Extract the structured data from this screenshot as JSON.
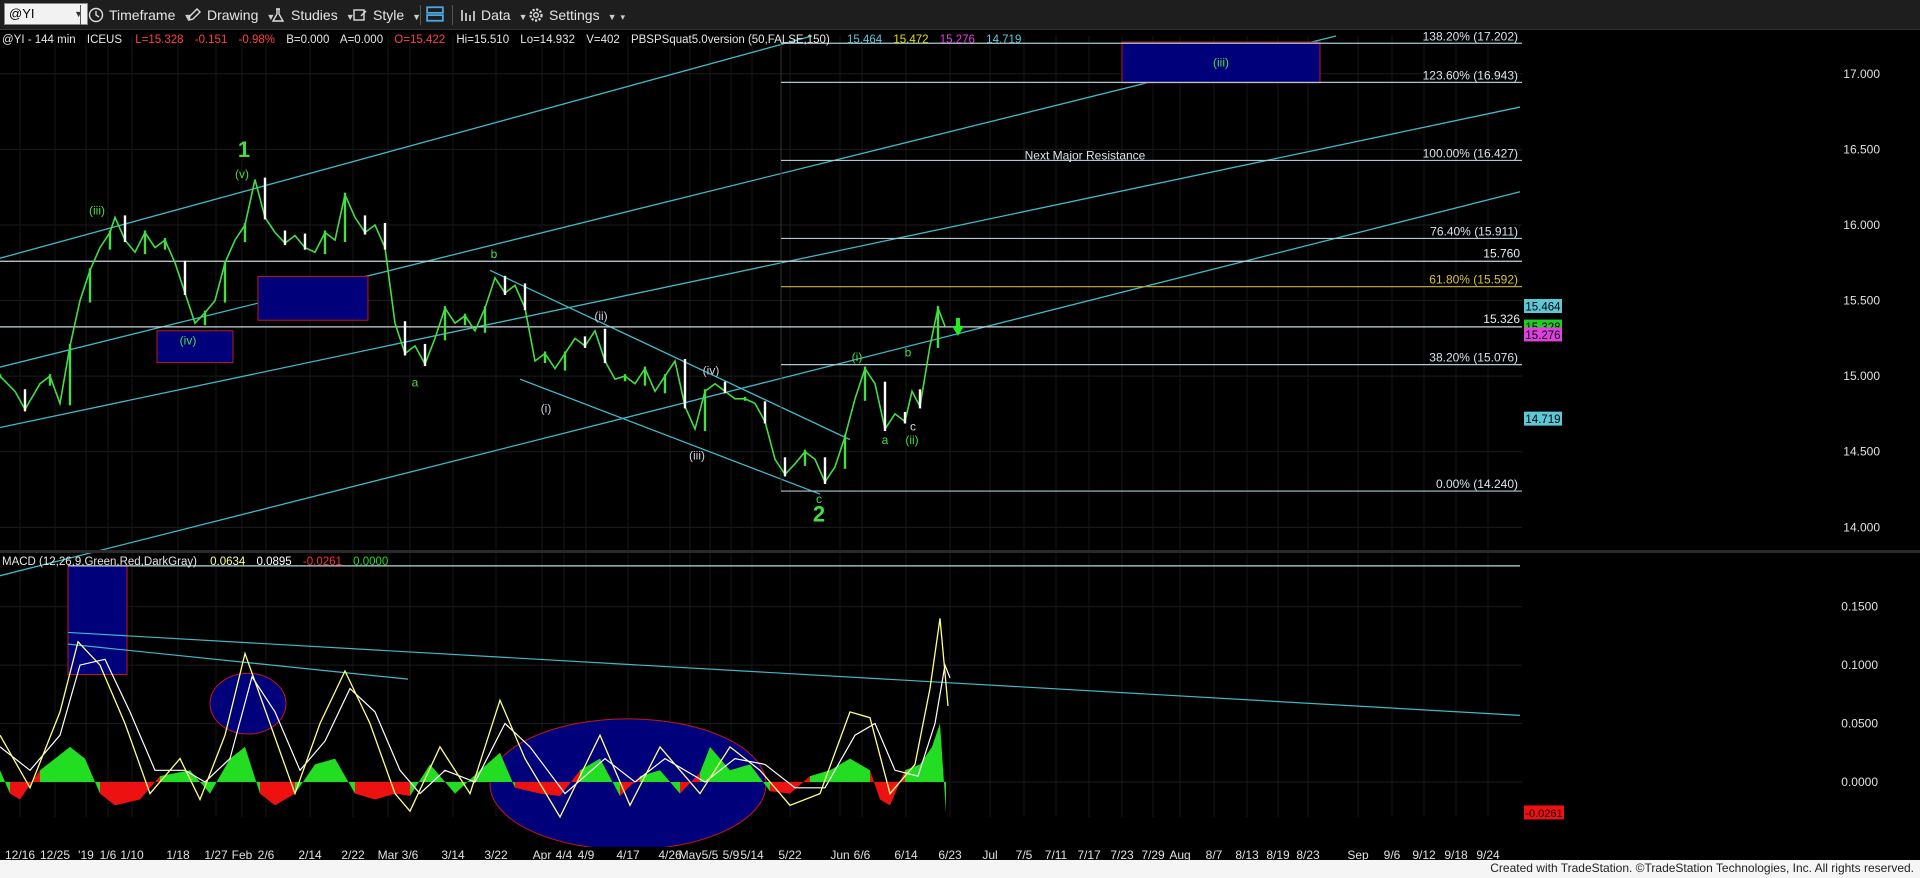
{
  "toolbar": {
    "symbol": "@YI",
    "timeframe": "Timeframe",
    "drawing": "Drawing",
    "studies": "Studies",
    "style": "Style",
    "data": "Data",
    "settings": "Settings"
  },
  "chart_header": {
    "symbol_desc": "@YI - 144 min",
    "exchange": "ICEUS",
    "last": "L=15.328",
    "change": "-0.151",
    "change_pct": "-0.98%",
    "bid": "B=0.000",
    "ask": "A=0.000",
    "open": "O=15.422",
    "hi": "Hi=15.510",
    "lo": "Lo=14.932",
    "volume": "V=402",
    "study": "PBSPSquat5.0version (50,FALSE,150)",
    "study_values": [
      {
        "value": "15.464",
        "color": "#5ec8d8"
      },
      {
        "value": "15.472",
        "color": "#e0e000"
      },
      {
        "value": "15.276",
        "color": "#e040e0"
      },
      {
        "value": "14.719",
        "color": "#5ec8d8"
      }
    ]
  },
  "colors": {
    "background": "#000000",
    "channel": "#40b8c8",
    "box_fill": "#00007a",
    "box_stroke": "#c01818",
    "wave_label": "#44dd44",
    "wave_label_white": "#d0d0e0",
    "price_line": "#4ea8d0",
    "candle_up": "#44dd44",
    "candle_down": "#ffffff",
    "macd_line": "#ffff88",
    "signal_line": "#ffffff",
    "hist_pos": "#22dd22",
    "hist_neg": "#ee1111",
    "fib_line": "#aac8d0",
    "fib_gold": "#b8a030"
  },
  "chart_data": {
    "type": "candlestick",
    "symbol": "@YI",
    "interval": "144 min",
    "ylim": [
      13.85,
      17.25
    ],
    "y_ticks": [
      "17.000",
      "16.500",
      "16.000",
      "15.500",
      "15.000",
      "14.500",
      "14.000"
    ],
    "x_ticks": [
      "12/16",
      "12/25",
      "'19",
      "1/6",
      "1/10",
      "1/18",
      "1/27",
      "Feb",
      "2/6",
      "2/14",
      "2/22",
      "Mar",
      "3/6",
      "3/14",
      "3/22",
      "Apr",
      "4/4",
      "4/9",
      "4/17",
      "4/26",
      "May",
      "5/5",
      "5/9",
      "5/14",
      "5/22",
      "Jun",
      "6/6",
      "6/14",
      "6/23",
      "Jul",
      "7/5",
      "7/11",
      "7/17",
      "7/23",
      "7/29",
      "Aug",
      "8/7",
      "8/13",
      "8/19",
      "8/23",
      "Sep",
      "9/6",
      "9/12",
      "9/18",
      "9/24"
    ],
    "price_path": [
      [
        0,
        15.0
      ],
      [
        15,
        14.9
      ],
      [
        25,
        14.78
      ],
      [
        40,
        14.95
      ],
      [
        50,
        15.0
      ],
      [
        60,
        14.82
      ],
      [
        70,
        15.2
      ],
      [
        80,
        15.5
      ],
      [
        90,
        15.7
      ],
      [
        100,
        15.85
      ],
      [
        110,
        15.95
      ],
      [
        115,
        16.05
      ],
      [
        125,
        15.9
      ],
      [
        135,
        15.82
      ],
      [
        145,
        15.95
      ],
      [
        155,
        15.85
      ],
      [
        165,
        15.9
      ],
      [
        175,
        15.75
      ],
      [
        185,
        15.55
      ],
      [
        195,
        15.35
      ],
      [
        205,
        15.42
      ],
      [
        215,
        15.5
      ],
      [
        225,
        15.75
      ],
      [
        235,
        15.9
      ],
      [
        245,
        16.0
      ],
      [
        255,
        16.3
      ],
      [
        265,
        16.05
      ],
      [
        275,
        15.95
      ],
      [
        285,
        15.88
      ],
      [
        295,
        15.93
      ],
      [
        305,
        15.85
      ],
      [
        315,
        15.82
      ],
      [
        325,
        15.95
      ],
      [
        335,
        15.9
      ],
      [
        345,
        16.2
      ],
      [
        355,
        16.05
      ],
      [
        365,
        15.95
      ],
      [
        375,
        16.0
      ],
      [
        385,
        15.85
      ],
      [
        395,
        15.35
      ],
      [
        405,
        15.15
      ],
      [
        415,
        15.2
      ],
      [
        425,
        15.08
      ],
      [
        435,
        15.25
      ],
      [
        445,
        15.45
      ],
      [
        455,
        15.35
      ],
      [
        465,
        15.4
      ],
      [
        475,
        15.3
      ],
      [
        485,
        15.45
      ],
      [
        495,
        15.65
      ],
      [
        505,
        15.55
      ],
      [
        515,
        15.6
      ],
      [
        525,
        15.45
      ],
      [
        535,
        15.1
      ],
      [
        545,
        15.15
      ],
      [
        555,
        15.05
      ],
      [
        565,
        15.15
      ],
      [
        575,
        15.25
      ],
      [
        585,
        15.2
      ],
      [
        595,
        15.3
      ],
      [
        605,
        15.1
      ],
      [
        615,
        14.98
      ],
      [
        625,
        15.0
      ],
      [
        635,
        14.95
      ],
      [
        645,
        15.05
      ],
      [
        655,
        14.9
      ],
      [
        665,
        15.0
      ],
      [
        675,
        15.1
      ],
      [
        685,
        14.8
      ],
      [
        695,
        14.65
      ],
      [
        705,
        14.9
      ],
      [
        715,
        14.95
      ],
      [
        725,
        14.9
      ],
      [
        735,
        14.85
      ],
      [
        745,
        14.85
      ],
      [
        755,
        14.82
      ],
      [
        765,
        14.7
      ],
      [
        775,
        14.45
      ],
      [
        785,
        14.35
      ],
      [
        795,
        14.42
      ],
      [
        805,
        14.5
      ],
      [
        815,
        14.45
      ],
      [
        825,
        14.3
      ],
      [
        835,
        14.4
      ],
      [
        845,
        14.6
      ],
      [
        855,
        14.85
      ],
      [
        865,
        15.05
      ],
      [
        875,
        14.95
      ],
      [
        885,
        14.65
      ],
      [
        895,
        14.75
      ],
      [
        905,
        14.7
      ],
      [
        912,
        14.9
      ],
      [
        920,
        14.8
      ],
      [
        930,
        15.2
      ],
      [
        938,
        15.45
      ],
      [
        945,
        15.33
      ]
    ],
    "fibonacci": {
      "x_start": 781,
      "levels": [
        {
          "label": "138.20% (17.202)",
          "value": 17.202
        },
        {
          "label": "123.60% (16.943)",
          "value": 16.943
        },
        {
          "label": "100.00% (16.427)",
          "value": 16.427
        },
        {
          "label": "76.40% (15.911)",
          "value": 15.911
        },
        {
          "label": "61.80% (15.592)",
          "value": 15.592
        },
        {
          "label": "38.20% (15.076)",
          "value": 15.076
        },
        {
          "label": "0.00% (14.240)",
          "value": 14.24
        }
      ]
    },
    "horizontal_lines": [
      {
        "label": "15.760",
        "value": 15.76
      },
      {
        "label": "15.326",
        "value": 15.326
      }
    ],
    "annotations": [
      {
        "text": "Next Major Resistance",
        "x": 1085,
        "value": 16.46
      }
    ],
    "price_markers": [
      {
        "label": "15.464",
        "value": 15.464,
        "bg": "#5ec8d8",
        "fg": "#000"
      },
      {
        "label": "15.328",
        "value": 15.328,
        "bg": "#22cc22",
        "fg": "#000"
      },
      {
        "label": "15.276",
        "value": 15.276,
        "bg": "#e040e0",
        "fg": "#000"
      },
      {
        "label": "14.719",
        "value": 14.719,
        "bg": "#5ec8d8",
        "fg": "#000"
      }
    ],
    "boxes": [
      {
        "x0": 157,
        "x1": 233,
        "v0": 15.3,
        "v1": 15.09
      },
      {
        "x0": 258,
        "x1": 368,
        "v0": 15.66,
        "v1": 15.37
      },
      {
        "x0": 1122,
        "x1": 1320,
        "v0": 17.21,
        "v1": 16.94,
        "label": "(iii)"
      }
    ],
    "channels": [
      [
        [
          0,
          15.78
        ],
        [
          812,
          17.25
        ]
      ],
      [
        [
          0,
          15.06
        ],
        [
          1336,
          17.25
        ]
      ],
      [
        [
          0,
          14.66
        ],
        [
          1520,
          16.78
        ]
      ],
      [
        [
          0,
          13.68
        ],
        [
          1520,
          16.22
        ]
      ],
      [
        [
          490,
          15.7
        ],
        [
          850,
          14.58
        ]
      ],
      [
        [
          520,
          14.98
        ],
        [
          820,
          14.22
        ]
      ]
    ],
    "wave_labels": [
      {
        "text": "(iii)",
        "x": 97,
        "value": 16.07,
        "color": "green"
      },
      {
        "text": "1",
        "x": 244,
        "value": 16.45,
        "color": "green",
        "large": true
      },
      {
        "text": "(v)",
        "x": 242,
        "value": 16.31,
        "color": "green"
      },
      {
        "text": "(iv)",
        "x": 188,
        "value": 15.21,
        "color": "green"
      },
      {
        "text": "b",
        "x": 494,
        "value": 15.78,
        "color": "green"
      },
      {
        "text": "a",
        "x": 415,
        "value": 14.93,
        "color": "green"
      },
      {
        "text": "(ii)",
        "x": 601,
        "value": 15.37,
        "color": "white"
      },
      {
        "text": "(i)",
        "x": 546,
        "value": 14.76,
        "color": "white"
      },
      {
        "text": "(iv)",
        "x": 711,
        "value": 15.01,
        "color": "white"
      },
      {
        "text": "(iii)",
        "x": 697,
        "value": 14.45,
        "color": "white"
      },
      {
        "text": "c",
        "x": 819,
        "value": 14.16,
        "color": "green"
      },
      {
        "text": "2",
        "x": 819,
        "value": 14.04,
        "color": "green",
        "large": true
      },
      {
        "text": "(i)",
        "x": 857,
        "value": 15.1,
        "color": "green"
      },
      {
        "text": "b",
        "x": 908,
        "value": 15.13,
        "color": "green"
      },
      {
        "text": "a",
        "x": 885,
        "value": 14.55,
        "color": "green"
      },
      {
        "text": "c",
        "x": 913,
        "value": 14.64,
        "color": "white"
      },
      {
        "text": "(ii)",
        "x": 912,
        "value": 14.55,
        "color": "green"
      }
    ],
    "macd": {
      "title": "MACD (12,26,9,Green,Red,DarkGray)",
      "values": [
        {
          "value": "0.0634",
          "color": "#ffff88"
        },
        {
          "value": "0.0895",
          "color": "#ffffff"
        },
        {
          "value": "-0.0261",
          "color": "#ff3030"
        },
        {
          "value": "0.0000",
          "color": "#22dd22"
        }
      ],
      "ylim": [
        -0.03,
        0.19
      ],
      "y_ticks": [
        "0.1500",
        "0.1000",
        "0.0500",
        "0.0000"
      ],
      "current_marker": "-0.0261",
      "boxes": [
        {
          "x0": 68,
          "x1": 127,
          "v0": 0.185,
          "v1": 0.092
        }
      ],
      "ellipses": [
        {
          "cx": 248,
          "cy": 0.067,
          "rx": 38,
          "ry": 0.026
        },
        {
          "cx": 628,
          "cy": -0.002,
          "rx": 138,
          "ry": 0.056
        }
      ],
      "trendlines": [
        [
          [
            68,
            0.185
          ],
          [
            1520,
            0.185
          ]
        ],
        [
          [
            68,
            0.128
          ],
          [
            1520,
            0.057
          ]
        ],
        [
          [
            68,
            0.118
          ],
          [
            408,
            0.088
          ]
        ]
      ],
      "macd_line": [
        [
          0,
          0.04
        ],
        [
          30,
          -0.005
        ],
        [
          60,
          0.06
        ],
        [
          78,
          0.12
        ],
        [
          100,
          0.1
        ],
        [
          125,
          0.05
        ],
        [
          150,
          -0.01
        ],
        [
          180,
          0.02
        ],
        [
          200,
          -0.015
        ],
        [
          225,
          0.04
        ],
        [
          245,
          0.11
        ],
        [
          270,
          0.05
        ],
        [
          295,
          -0.01
        ],
        [
          320,
          0.05
        ],
        [
          345,
          0.095
        ],
        [
          370,
          0.05
        ],
        [
          395,
          -0.01
        ],
        [
          410,
          -0.025
        ],
        [
          440,
          0.03
        ],
        [
          470,
          -0.01
        ],
        [
          500,
          0.07
        ],
        [
          525,
          0.02
        ],
        [
          560,
          -0.03
        ],
        [
          600,
          0.04
        ],
        [
          630,
          -0.02
        ],
        [
          660,
          0.03
        ],
        [
          700,
          -0.01
        ],
        [
          730,
          0.03
        ],
        [
          760,
          0.01
        ],
        [
          790,
          -0.02
        ],
        [
          820,
          -0.01
        ],
        [
          850,
          0.06
        ],
        [
          870,
          0.055
        ],
        [
          890,
          -0.01
        ],
        [
          915,
          0.015
        ],
        [
          930,
          0.08
        ],
        [
          940,
          0.14
        ],
        [
          948,
          0.065
        ]
      ],
      "signal_line": [
        [
          0,
          0.03
        ],
        [
          30,
          0.01
        ],
        [
          60,
          0.04
        ],
        [
          80,
          0.1
        ],
        [
          105,
          0.105
        ],
        [
          130,
          0.06
        ],
        [
          155,
          0.01
        ],
        [
          185,
          0.01
        ],
        [
          205,
          0.0
        ],
        [
          230,
          0.02
        ],
        [
          252,
          0.09
        ],
        [
          275,
          0.06
        ],
        [
          300,
          0.01
        ],
        [
          325,
          0.035
        ],
        [
          350,
          0.08
        ],
        [
          375,
          0.06
        ],
        [
          400,
          0.01
        ],
        [
          420,
          -0.01
        ],
        [
          445,
          0.01
        ],
        [
          475,
          0.0
        ],
        [
          505,
          0.05
        ],
        [
          530,
          0.03
        ],
        [
          565,
          -0.01
        ],
        [
          605,
          0.02
        ],
        [
          635,
          0.0
        ],
        [
          665,
          0.02
        ],
        [
          705,
          0.0
        ],
        [
          735,
          0.02
        ],
        [
          765,
          0.015
        ],
        [
          795,
          -0.005
        ],
        [
          825,
          -0.005
        ],
        [
          855,
          0.04
        ],
        [
          875,
          0.05
        ],
        [
          895,
          0.01
        ],
        [
          918,
          0.005
        ],
        [
          935,
          0.05
        ],
        [
          945,
          0.1
        ],
        [
          950,
          0.089
        ]
      ],
      "histogram": [
        [
          0,
          0.01
        ],
        [
          10,
          -0.01
        ],
        [
          20,
          -0.015
        ],
        [
          40,
          0.01
        ],
        [
          55,
          0.02
        ],
        [
          70,
          0.03
        ],
        [
          85,
          0.02
        ],
        [
          100,
          -0.01
        ],
        [
          115,
          -0.02
        ],
        [
          140,
          -0.015
        ],
        [
          160,
          0.005
        ],
        [
          190,
          0.01
        ],
        [
          210,
          -0.01
        ],
        [
          230,
          0.02
        ],
        [
          245,
          0.03
        ],
        [
          260,
          -0.01
        ],
        [
          275,
          -0.02
        ],
        [
          295,
          -0.01
        ],
        [
          315,
          0.015
        ],
        [
          335,
          0.02
        ],
        [
          355,
          -0.01
        ],
        [
          375,
          -0.015
        ],
        [
          395,
          -0.01
        ],
        [
          410,
          -0.012
        ],
        [
          430,
          0.015
        ],
        [
          455,
          -0.01
        ],
        [
          480,
          0.01
        ],
        [
          500,
          0.025
        ],
        [
          515,
          -0.005
        ],
        [
          540,
          -0.01
        ],
        [
          560,
          -0.012
        ],
        [
          580,
          0.01
        ],
        [
          600,
          0.02
        ],
        [
          620,
          -0.012
        ],
        [
          640,
          0.005
        ],
        [
          660,
          0.01
        ],
        [
          680,
          -0.01
        ],
        [
          700,
          0.008
        ],
        [
          710,
          0.03
        ],
        [
          730,
          0.01
        ],
        [
          750,
          0.015
        ],
        [
          770,
          -0.008
        ],
        [
          790,
          -0.01
        ],
        [
          810,
          0.005
        ],
        [
          830,
          0.01
        ],
        [
          850,
          0.02
        ],
        [
          870,
          0.01
        ],
        [
          880,
          -0.015
        ],
        [
          890,
          -0.02
        ],
        [
          905,
          0.01
        ],
        [
          920,
          0.015
        ],
        [
          932,
          0.03
        ],
        [
          940,
          0.05
        ],
        [
          946,
          -0.026
        ]
      ]
    }
  },
  "footer": {
    "credit": "Created with TradeStation. ©TradeStation Technologies, Inc. All rights reserved."
  }
}
